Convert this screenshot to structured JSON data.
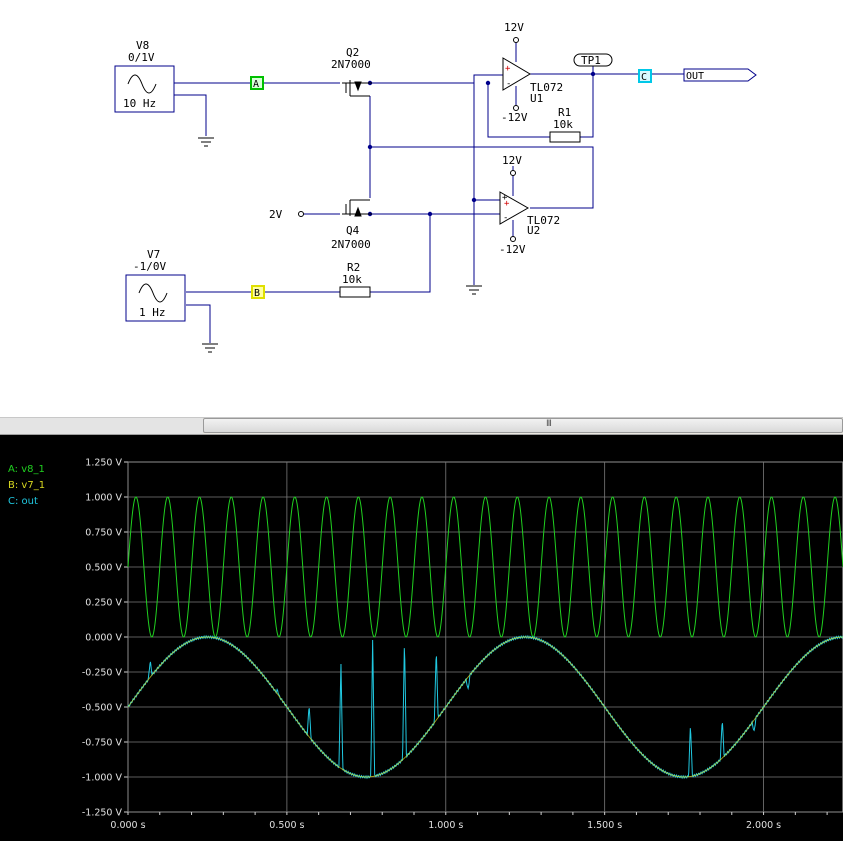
{
  "schematic": {
    "v8": {
      "name": "V8",
      "value": "0/1V",
      "freq": "10 Hz"
    },
    "v7": {
      "name": "V7",
      "value": "-1/0V",
      "freq": "1 Hz"
    },
    "q2": {
      "name": "Q2",
      "model": "2N7000"
    },
    "q4": {
      "name": "Q4",
      "model": "2N7000"
    },
    "u1": {
      "model": "TL072",
      "ref": "U1",
      "vpos": "12V",
      "vneg": "-12V"
    },
    "u2": {
      "model": "TL072",
      "ref": "U2",
      "vpos": "12V",
      "vneg": "-12V"
    },
    "r1": {
      "name": "R1",
      "value": "10k"
    },
    "r2": {
      "name": "R2",
      "value": "10k"
    },
    "gate_bias": "2V",
    "probes": {
      "a": "A",
      "b": "B",
      "c": "C"
    },
    "testpoint": "TP1",
    "out_label": "OUT",
    "colors": {
      "wire": "#00008b",
      "probe_a": "#00c000",
      "probe_b": "#e0e000",
      "probe_c": "#00c8e8"
    }
  },
  "scrollbar": {
    "grip": "III"
  },
  "legend": {
    "a": "A: v8_1",
    "b": "B: v7_1",
    "c": "C: out"
  },
  "chart_data": {
    "type": "line",
    "xlim": [
      0,
      2.25
    ],
    "ylim": [
      -1.25,
      1.25
    ],
    "xticks": [
      "0.000 s",
      "0.500 s",
      "1.000 s",
      "1.500 s",
      "2.000 s"
    ],
    "xtick_values": [
      0,
      0.5,
      1.0,
      1.5,
      2.0
    ],
    "yticks": [
      "1.250 V",
      "1.000 V",
      "0.750 V",
      "0.500 V",
      "0.250 V",
      "0.000 V",
      "-0.250 V",
      "-0.500 V",
      "-0.750 V",
      "-1.000 V",
      "-1.250 V"
    ],
    "ytick_values": [
      1.25,
      1.0,
      0.75,
      0.5,
      0.25,
      0.0,
      -0.25,
      -0.5,
      -0.75,
      -1.0,
      -1.25
    ],
    "grid": true,
    "series": [
      {
        "name": "A: v8_1",
        "color": "#20d020",
        "function": "sine",
        "offset": 0.5,
        "amplitude": 0.5,
        "frequency_hz": 10,
        "phase_deg": 0
      },
      {
        "name": "B: v7_1",
        "color": "#d8d820",
        "function": "sine",
        "offset": -0.5,
        "amplitude": 0.5,
        "frequency_hz": 1,
        "phase_deg": 0
      },
      {
        "name": "C: out",
        "color": "#20c8e0",
        "function": "tracks B with spikes",
        "spikes": [
          [
            0.07,
            -0.17
          ],
          [
            0.47,
            -0.38
          ],
          [
            0.57,
            -0.48
          ],
          [
            0.67,
            -0.17
          ],
          [
            0.77,
            0.0
          ],
          [
            0.87,
            0.0
          ],
          [
            0.97,
            -0.08
          ],
          [
            1.07,
            -0.38
          ],
          [
            1.77,
            -0.62
          ],
          [
            1.87,
            -0.58
          ],
          [
            1.97,
            -0.68
          ]
        ]
      }
    ]
  }
}
